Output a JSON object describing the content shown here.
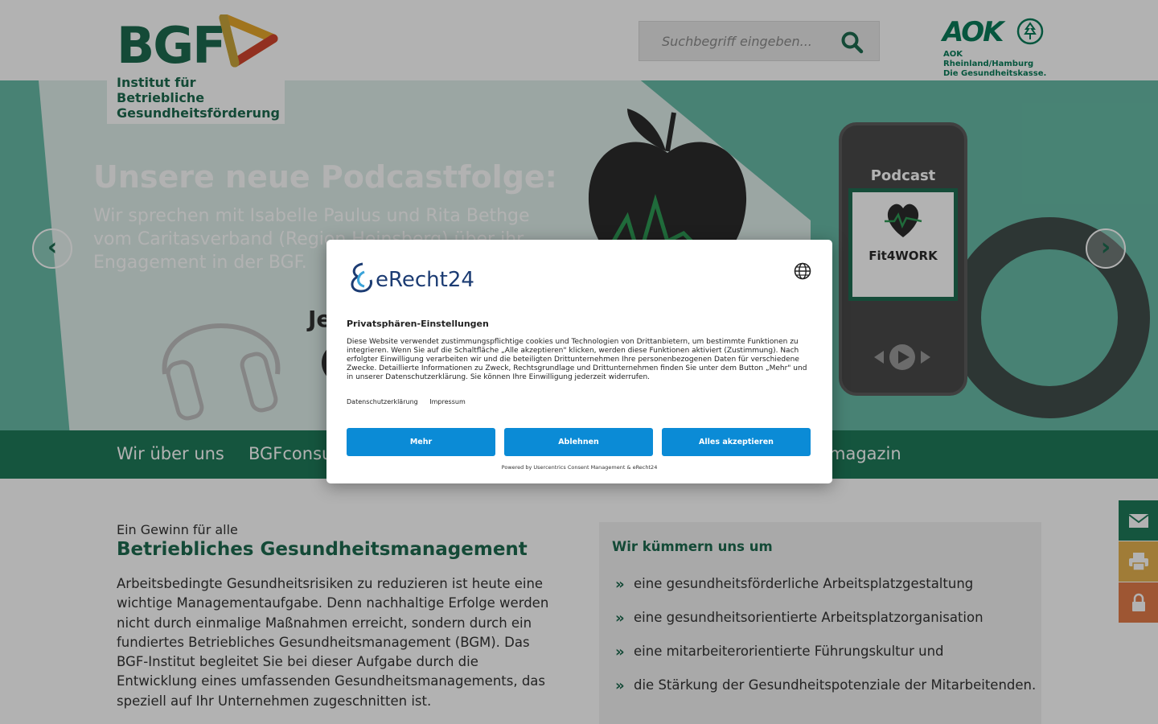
{
  "header": {
    "logo": {
      "word": "BGF",
      "subtitle_line1": "Institut für Betriebliche",
      "subtitle_line2": "Gesundheitsförderung"
    },
    "search": {
      "placeholder": "Suchbegriff eingeben...",
      "icon": "search-icon"
    },
    "partner": {
      "word": "AOK",
      "line1": "AOK Rheinland/Hamburg",
      "line2": "Die Gesundheitskasse."
    }
  },
  "hero": {
    "title": "Unsere neue Podcastfolge:",
    "text": "Wir sprechen mit Isabelle Paulus und Rita Bethge vom Caritasverband (Region Heinsberg) über ihr Engagement in der BGF.",
    "cta_partial": "Je",
    "phone": {
      "title": "Podcast",
      "cover": "Fit4WORK"
    },
    "arrows": {
      "prev": "‹",
      "next": "›"
    }
  },
  "nav": {
    "items": [
      {
        "label": "Wir über uns"
      },
      {
        "label": "BGFconsu"
      },
      {
        "label": "magazin"
      }
    ]
  },
  "content": {
    "kicker": "Ein Gewinn für alle",
    "title": "Betriebliches Gesundheitsmanagement",
    "body": "Arbeitsbedingte Gesundheitsrisiken zu reduzieren ist heute eine wichtige Managementaufgabe. Denn nachhaltige Erfolge werden nicht durch einmalige Maßnahmen erreicht, sondern durch ein fundiertes Betriebliches Gesundheitsmanagement (BGM). Das BGF-Institut begleitet Sie bei dieser Aufgabe durch die Entwicklung eines umfassenden Gesundheitsmanagements, das speziell auf Ihr Unternehmen zugeschnitten ist."
  },
  "sidebox": {
    "title": "Wir kümmern uns um",
    "items": [
      "eine gesundheitsförderliche Arbeitsplatzgestaltung",
      "eine gesundheitsorientierte Arbeitsplatzorganisation",
      "eine mitarbeiterorientierte Führungskultur und",
      "die Stärkung der Gesundheitspotenziale der Mitarbeitenden."
    ]
  },
  "side_buttons": [
    {
      "icon": "mail-icon",
      "color": "#1f7a5a"
    },
    {
      "icon": "print-icon",
      "color": "#e6b24f"
    },
    {
      "icon": "lock-icon",
      "color": "#e27c4a"
    }
  ],
  "consent": {
    "logo_text": "eRecht24",
    "heading": "Privatsphären-Einstellungen",
    "text": "Diese Website verwendet zustimmungspflichtige cookies und Technologien von Drittanbietern, um bestimmte Funktionen zu integrieren. Wenn Sie auf die Schaltfläche „Alle akzeptieren\" klicken, werden diese Funktionen aktiviert (Zustimmung). Nach erfolgter Einwilligung verarbeiten wir und die beteiligten Drittunternehmen Ihre personenbezogenen Daten für verschiedene Zwecke. Detaillierte Informationen zu Zweck, Rechtsgrundlage und Drittunternehmen finden Sie unter dem Button „Mehr\" und in unserer Datenschutzerklärung. Sie können Ihre Einwilligung jederzeit widerrufen.",
    "links": {
      "privacy": "Datenschutzerklärung",
      "imprint": "Impressum"
    },
    "buttons": {
      "more": "Mehr",
      "reject": "Ablehnen",
      "accept": "Alles akzeptieren"
    },
    "footer": "Powered by Usercentrics Consent Management & eRecht24",
    "accent_color": "#0b8bd6"
  },
  "colors": {
    "brand_green": "#1e6a4f",
    "nav_green": "#1f7a5a",
    "hero_teal": "#67bba6"
  }
}
